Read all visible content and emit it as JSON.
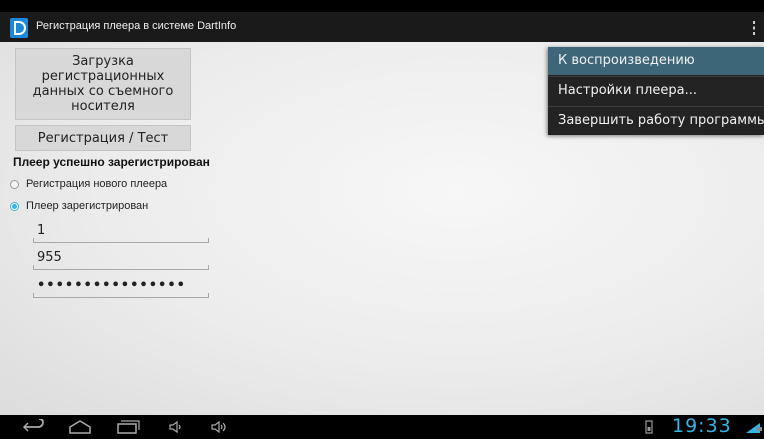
{
  "app": {
    "title": "Регистрация плеера в системе DartInfo",
    "accent_color": "#33b5e5"
  },
  "buttons": {
    "load_label": "Загрузка регистрационных данных со съемного носителя",
    "register_label": "Регистрация / Тест"
  },
  "status": {
    "message": "Плеер успешно зарегистрирован"
  },
  "radios": [
    {
      "label": "Регистрация нового плеера",
      "checked": false
    },
    {
      "label": "Плеер зарегистрирован",
      "checked": true
    }
  ],
  "fields": {
    "field1_value": "1",
    "field2_value": "955",
    "password_value": "••••••••••••••••"
  },
  "menu": {
    "items": [
      {
        "label": "К воспроизведению",
        "highlighted": true
      },
      {
        "label": "Настройки плеера...",
        "highlighted": false
      },
      {
        "label": "Завершить работу программы",
        "highlighted": false
      }
    ]
  },
  "navbar": {
    "clock": "19:33",
    "icons": [
      "back-icon",
      "home-icon",
      "recent-apps-icon",
      "volume-down-icon",
      "volume-up-icon",
      "sd-card-icon",
      "signal-icon"
    ]
  }
}
